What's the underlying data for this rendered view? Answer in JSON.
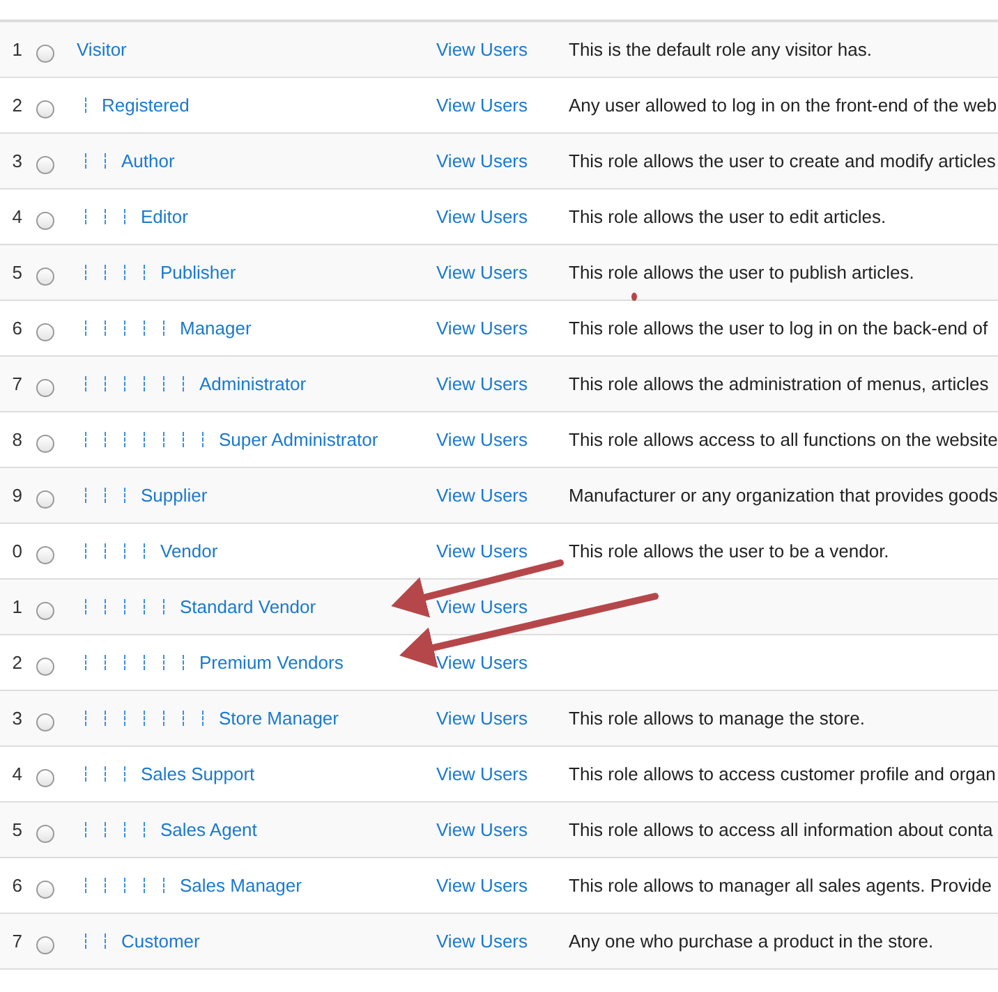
{
  "roles": [
    {
      "number": "1",
      "name": "Visitor",
      "link": "View Users",
      "description": "This is the default role any visitor has.",
      "selected": false,
      "children": [
        {
          "number": "2",
          "name": "Registered",
          "link": "View Users",
          "description": "Any user allowed to log in on the front-end of the web",
          "selected": false,
          "children": [
            {
              "number": "3",
              "name": "Author",
              "link": "View Users",
              "description": "This role allows the user to create and modify articles",
              "selected": false,
              "children": [
                {
                  "number": "4",
                  "name": "Editor",
                  "link": "View Users",
                  "description": "This role allows the user to edit articles.",
                  "selected": false,
                  "children": [
                    {
                      "number": "5",
                      "name": "Publisher",
                      "link": "View Users",
                      "description": "This role allows the user to publish articles.",
                      "selected": false,
                      "children": [
                        {
                          "number": "6",
                          "name": "Manager",
                          "link": "View Users",
                          "description": "This role allows the user to log in on the back-end of",
                          "selected": false,
                          "children": [
                            {
                              "number": "7",
                              "name": "Administrator",
                              "link": "View Users",
                              "description": "This role allows the administration of menus, articles",
                              "selected": false,
                              "children": [
                                {
                                  "number": "8",
                                  "name": "Super Administrator",
                                  "link": "View Users",
                                  "description": "This role allows access to all functions on the website",
                                  "selected": false
                                }
                              ]
                            }
                          ]
                        }
                      ]
                    }
                  ]
                },
                {
                  "number": "9",
                  "name": "Supplier",
                  "link": "View Users",
                  "description": "Manufacturer or any organization that provides goods",
                  "selected": false,
                  "children": [
                    {
                      "number": "0",
                      "name": "Vendor",
                      "link": "View Users",
                      "description": "This role allows the user to be a vendor.",
                      "selected": false,
                      "children": [
                        {
                          "number": "1",
                          "name": "Standard Vendor",
                          "link": "View Users",
                          "selected": false,
                          "children": [
                            {
                              "number": "2",
                              "name": "Premium Vendors",
                              "link": "View Users",
                              "selected": false,
                              "children": [
                                {
                                  "number": "3",
                                  "name": "Store Manager",
                                  "link": "View Users",
                                  "description": "This role allows to manage the store.",
                                  "selected": false
                                }
                              ]
                            }
                          ]
                        }
                      ]
                    }
                  ]
                },
                {
                  "number": "4",
                  "name": "Sales Support",
                  "link": "View Users",
                  "description": "This role allows to access customer profile and organ",
                  "selected": false,
                  "children": [
                    {
                      "number": "5",
                      "name": "Sales Agent",
                      "link": "View Users",
                      "description": "This role allows to access all information about conta",
                      "selected": false,
                      "children": [
                        {
                          "number": "6",
                          "name": "Sales Manager",
                          "link": "View Users",
                          "description": "This role allows to manager all sales agents. Provide",
                          "selected": false
                        }
                      ]
                    }
                  ]
                }
              ]
            },
            {
              "number": "7",
              "name": "Customer",
              "link": "View Users",
              "description": "Any one who purchase a product in the store.",
              "selected": false
            }
          ]
        }
      ]
    }
  ]
}
